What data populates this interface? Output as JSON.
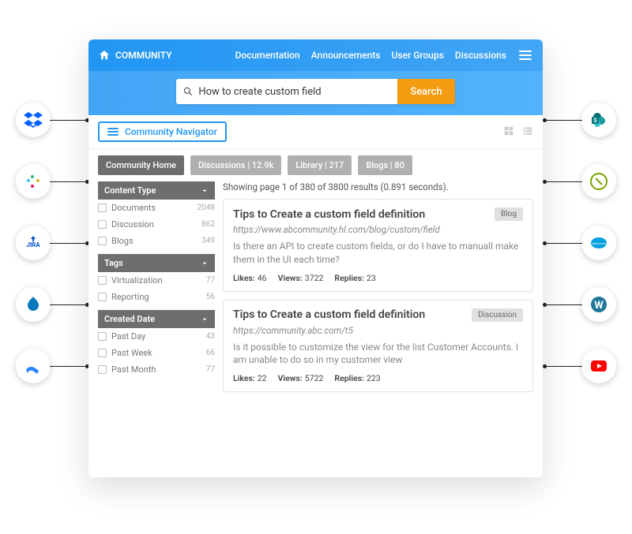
{
  "brand": "COMMUNITY",
  "topnav": [
    "Documentation",
    "Announcements",
    "User Groups",
    "Discussions"
  ],
  "search": {
    "value": "How to create custom field",
    "button": "Search"
  },
  "navigator_label": "Community Navigator",
  "tabs": [
    {
      "label": "Community Home",
      "active": true
    },
    {
      "label": "Discussions | 12.9k",
      "active": false
    },
    {
      "label": "Library | 217",
      "active": false
    },
    {
      "label": "Blogs | 80",
      "active": false
    }
  ],
  "results_meta": "Showing page 1 of 380 of 3800 results (0.891 seconds).",
  "filters": {
    "content_type": {
      "title": "Content Type",
      "items": [
        {
          "label": "Documents",
          "count": "2048"
        },
        {
          "label": "Discussion",
          "count": "862"
        },
        {
          "label": "Blogs",
          "count": "349"
        }
      ]
    },
    "tags": {
      "title": "Tags",
      "items": [
        {
          "label": "Virtualization",
          "count": "77"
        },
        {
          "label": "Reporting",
          "count": "56"
        }
      ]
    },
    "created_date": {
      "title": "Created Date",
      "items": [
        {
          "label": "Past Day",
          "count": "43"
        },
        {
          "label": "Past Week",
          "count": "66"
        },
        {
          "label": "Past Month",
          "count": "77"
        }
      ]
    }
  },
  "results": [
    {
      "title": "Tips to Create a custom field definition",
      "badge": "Blog",
      "url": "https://www.abcommunity.hl.com/blog/custom/field",
      "excerpt": "Is there an API to create custom fields, or do I have to manuall make them in the UI each time?",
      "likes_label": "Likes:",
      "likes": "46",
      "views_label": "Views:",
      "views": "3722",
      "replies_label": "Replies:",
      "replies": "23"
    },
    {
      "title": "Tips to Create a custom field definition",
      "badge": "Discussion",
      "url": "https://community.abc.com/t5",
      "excerpt": "Is it possible to customize the view for the list Customer Accounts. I am unable to do so in my customer view",
      "likes_label": "Likes:",
      "likes": "22",
      "views_label": "Views:",
      "views": "5722",
      "replies_label": "Replies:",
      "replies": "223"
    }
  ],
  "integrations_left": [
    "dropbox",
    "slack",
    "jira",
    "drupal",
    "confluence"
  ],
  "integrations_right": [
    "sharepoint",
    "zendesk",
    "salesforce",
    "wordpress",
    "youtube"
  ]
}
